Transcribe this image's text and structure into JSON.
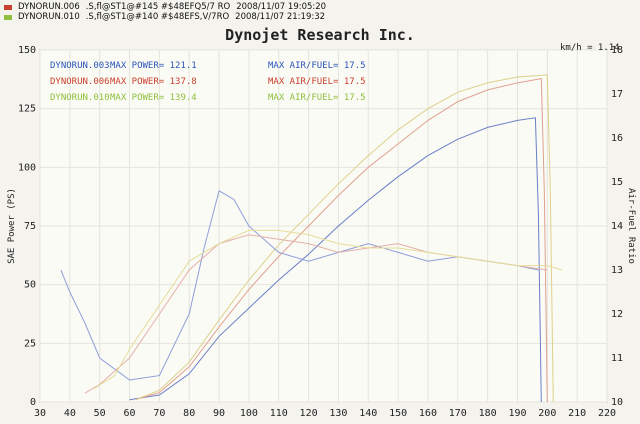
{
  "file_rows": [
    {
      "color": "#c9402c",
      "run": "DYNORUN.006",
      "meta": ".S,fl@ST1@#145 #$48EFQ5/7 RO",
      "date": "2008/11/07 19:05:20"
    },
    {
      "color": "#8fbf3c",
      "run": "DYNORUN.010",
      "meta": ".S,fl@ST1@#140 #$48EFS,V/7RO",
      "date": "2008/11/07 21:19:32"
    }
  ],
  "chart_data": {
    "type": "line",
    "title": "Dynojet  Research  Inc.",
    "xlabel": "",
    "ylabel_left": "SAE Power (PS)",
    "ylabel_right": "Air-Fuel Ratio",
    "x_unit_label": "km/h = 1.14",
    "xlim": [
      30,
      220
    ],
    "ylim_left": [
      0,
      150
    ],
    "ylim_right": [
      10,
      18
    ],
    "x_ticks": [
      "30",
      "40",
      "50",
      "60",
      "70",
      "80",
      "90",
      "100",
      "110",
      "120",
      "130",
      "140",
      "150",
      "160",
      "170",
      "180",
      "190",
      "200",
      "210",
      "220"
    ],
    "y_ticks_left": [
      "0",
      "25",
      "50",
      "75",
      "100",
      "125",
      "150"
    ],
    "y_ticks_right": [
      "10",
      "11",
      "12",
      "13",
      "14",
      "15",
      "16",
      "17",
      "18"
    ],
    "grid": true,
    "legend": [
      {
        "run": "DYNORUN.003",
        "power_label": "MAX POWER=",
        "power": "121.1",
        "afr_label": "MAX AIR/FUEL=",
        "afr": "17.5",
        "color": "#2b55b8"
      },
      {
        "run": "DYNORUN.006",
        "power_label": "MAX POWER=",
        "power": "137.8",
        "afr_label": "MAX AIR/FUEL=",
        "afr": "17.5",
        "color": "#c9402c"
      },
      {
        "run": "DYNORUN.010",
        "power_label": "MAX POWER=",
        "power": "139.4",
        "afr_label": "MAX AIR/FUEL=",
        "afr": "17.5",
        "color": "#8fbf3c"
      }
    ],
    "series": [
      {
        "name": "DYNORUN.003",
        "kind": "power",
        "color": "#6a7fc6",
        "x": [
          60,
          70,
          80,
          90,
          100,
          110,
          120,
          130,
          140,
          150,
          160,
          170,
          180,
          190,
          196,
          197,
          198
        ],
        "y": [
          1,
          3,
          12,
          28,
          40,
          52,
          63,
          75,
          86,
          96,
          105,
          112,
          117,
          120,
          121.1,
          80,
          0
        ]
      },
      {
        "name": "DYNORUN.006",
        "kind": "power",
        "color": "#e0a090",
        "x": [
          62,
          70,
          80,
          90,
          100,
          110,
          120,
          130,
          140,
          150,
          160,
          170,
          180,
          190,
          198,
          199,
          200
        ],
        "y": [
          1,
          4,
          15,
          32,
          48,
          62,
          75,
          88,
          100,
          110,
          120,
          128,
          133,
          136,
          137.8,
          90,
          0
        ]
      },
      {
        "name": "DYNORUN.010",
        "kind": "power",
        "color": "#ddd08a",
        "x": [
          62,
          70,
          80,
          90,
          100,
          110,
          120,
          130,
          140,
          150,
          160,
          170,
          180,
          190,
          200,
          201,
          202
        ],
        "y": [
          1,
          5,
          17,
          35,
          52,
          67,
          80,
          93,
          105,
          116,
          125,
          132,
          136,
          138.5,
          139.4,
          90,
          0
        ]
      },
      {
        "name": "DYNORUN.003",
        "kind": "afr",
        "color": "#8e9ed8",
        "x": [
          37,
          40,
          45,
          50,
          60,
          70,
          80,
          85,
          90,
          95,
          100,
          110,
          120,
          130,
          140,
          150,
          160,
          170,
          180,
          190,
          197
        ],
        "y": [
          13.0,
          12.5,
          11.8,
          11.0,
          10.5,
          10.6,
          12.0,
          13.5,
          14.8,
          14.6,
          14.0,
          13.4,
          13.2,
          13.4,
          13.6,
          13.4,
          13.2,
          13.3,
          13.2,
          13.1,
          13.0
        ]
      },
      {
        "name": "DYNORUN.006",
        "kind": "afr",
        "color": "#e3b0a8",
        "x": [
          45,
          50,
          60,
          70,
          80,
          90,
          100,
          110,
          120,
          130,
          140,
          150,
          160,
          170,
          180,
          190,
          200
        ],
        "y": [
          10.2,
          10.4,
          11.0,
          12.0,
          13.0,
          13.6,
          13.8,
          13.7,
          13.6,
          13.4,
          13.5,
          13.6,
          13.4,
          13.3,
          13.2,
          13.1,
          13.0
        ]
      },
      {
        "name": "DYNORUN.010",
        "kind": "afr",
        "color": "#e6dc9a",
        "x": [
          48,
          55,
          60,
          70,
          80,
          90,
          100,
          110,
          120,
          130,
          140,
          150,
          160,
          170,
          180,
          190,
          200,
          205
        ],
        "y": [
          10.3,
          10.6,
          11.2,
          12.2,
          13.2,
          13.6,
          13.9,
          13.9,
          13.8,
          13.6,
          13.5,
          13.5,
          13.4,
          13.3,
          13.2,
          13.1,
          13.1,
          13.0
        ]
      }
    ]
  }
}
